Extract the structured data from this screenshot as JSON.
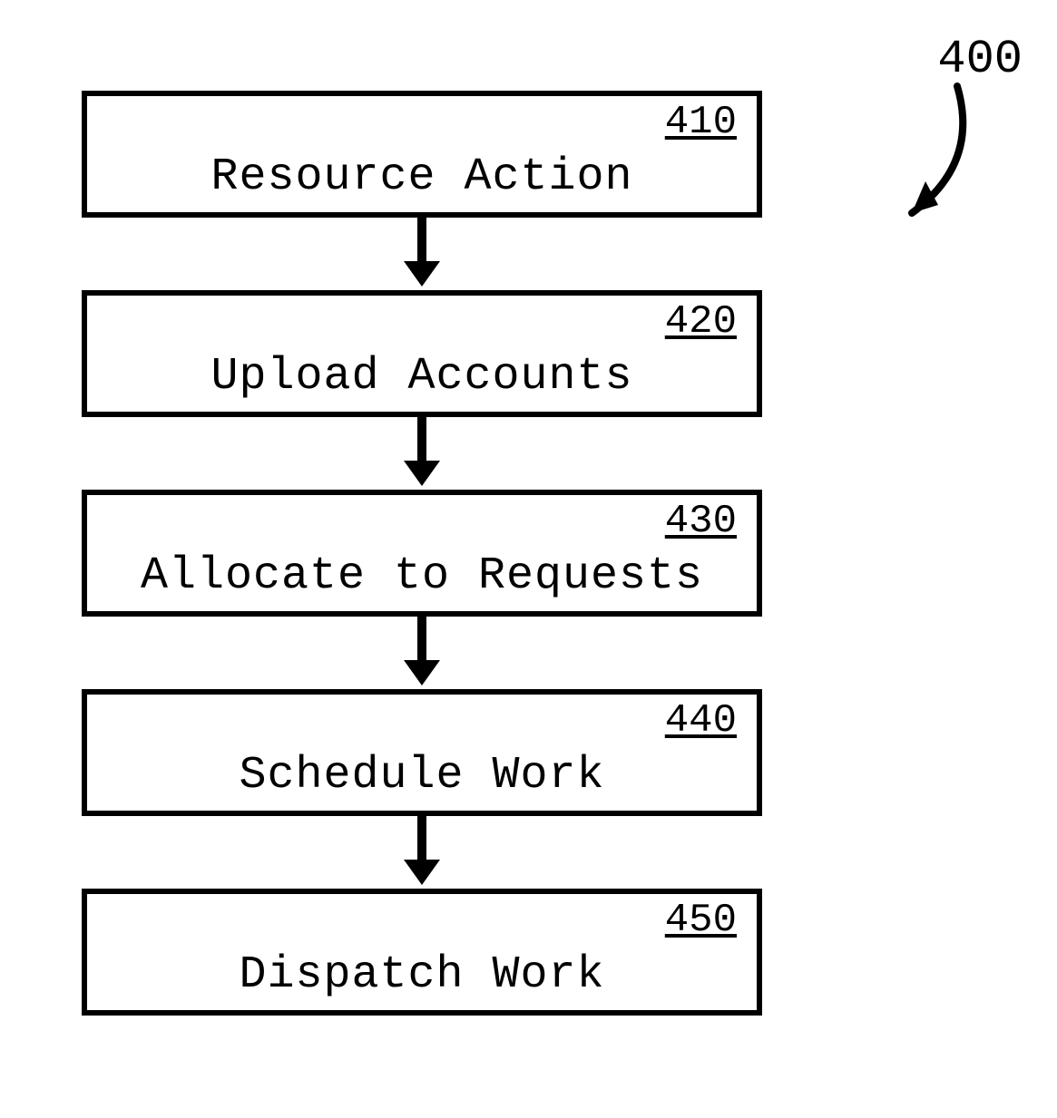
{
  "figure_number": "400",
  "steps": [
    {
      "num": "410",
      "label": "Resource Action"
    },
    {
      "num": "420",
      "label": "Upload Accounts"
    },
    {
      "num": "430",
      "label": "Allocate to Requests"
    },
    {
      "num": "440",
      "label": "Schedule Work"
    },
    {
      "num": "450",
      "label": "Dispatch Work"
    }
  ],
  "chart_data": {
    "type": "flowchart",
    "title": "",
    "nodes": [
      {
        "id": "410",
        "label": "Resource Action",
        "order": 1
      },
      {
        "id": "420",
        "label": "Upload Accounts",
        "order": 2
      },
      {
        "id": "430",
        "label": "Allocate to Requests",
        "order": 3
      },
      {
        "id": "440",
        "label": "Schedule Work",
        "order": 4
      },
      {
        "id": "450",
        "label": "Dispatch Work",
        "order": 5
      }
    ],
    "edges": [
      {
        "from": "410",
        "to": "420"
      },
      {
        "from": "420",
        "to": "430"
      },
      {
        "from": "430",
        "to": "440"
      },
      {
        "from": "440",
        "to": "450"
      }
    ],
    "figure_id": "400"
  }
}
